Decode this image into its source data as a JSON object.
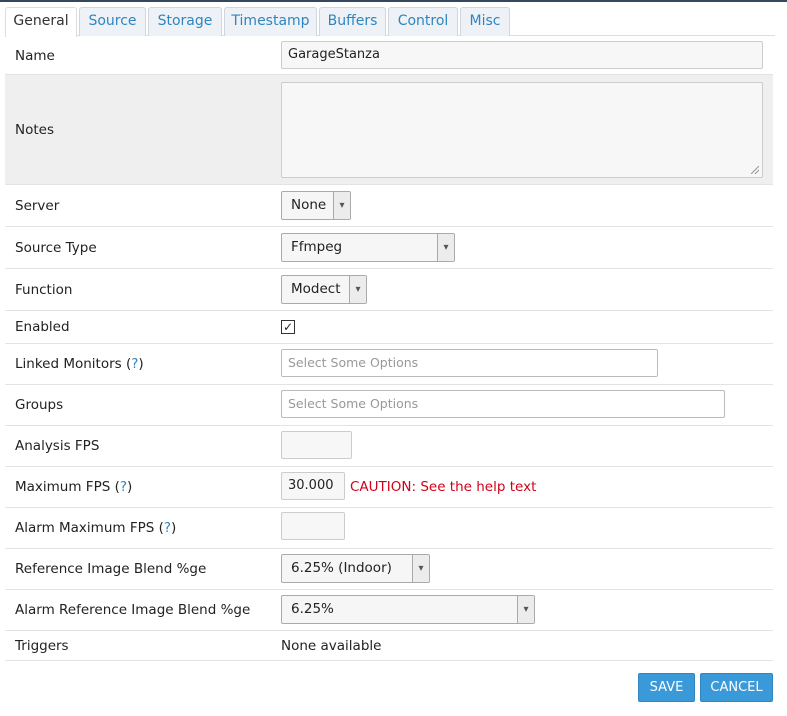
{
  "tabs": [
    "General",
    "Source",
    "Storage",
    "Timestamp",
    "Buffers",
    "Control",
    "Misc"
  ],
  "active_tab": "General",
  "fields": {
    "name": {
      "label": "Name",
      "value": "GarageStanza"
    },
    "notes": {
      "label": "Notes",
      "value": ""
    },
    "server": {
      "label": "Server",
      "value": "None"
    },
    "source_type": {
      "label": "Source Type",
      "value": "Ffmpeg"
    },
    "function": {
      "label": "Function",
      "value": "Modect"
    },
    "enabled": {
      "label": "Enabled",
      "checked": true,
      "mark": "✓"
    },
    "linked_monitors": {
      "label": "Linked Monitors",
      "help": "?",
      "placeholder": "Select Some Options"
    },
    "groups": {
      "label": "Groups",
      "placeholder": "Select Some Options"
    },
    "analysis_fps": {
      "label": "Analysis FPS",
      "value": ""
    },
    "maximum_fps": {
      "label": "Maximum FPS",
      "help": "?",
      "value": "30.000",
      "caution": "CAUTION: See the help text"
    },
    "alarm_maximum_fps": {
      "label": "Alarm Maximum FPS",
      "help": "?",
      "value": ""
    },
    "ref_blend": {
      "label": "Reference Image Blend %ge",
      "value": "6.25% (Indoor)"
    },
    "alarm_ref_blend": {
      "label": "Alarm Reference Image Blend %ge",
      "value": "6.25%"
    },
    "triggers": {
      "label": "Triggers",
      "value": "None available"
    }
  },
  "buttons": {
    "save": "SAVE",
    "cancel": "CANCEL"
  },
  "colors": {
    "accent": "#3a9ad9",
    "caution": "#d0021b",
    "help": "#2e86c1"
  }
}
